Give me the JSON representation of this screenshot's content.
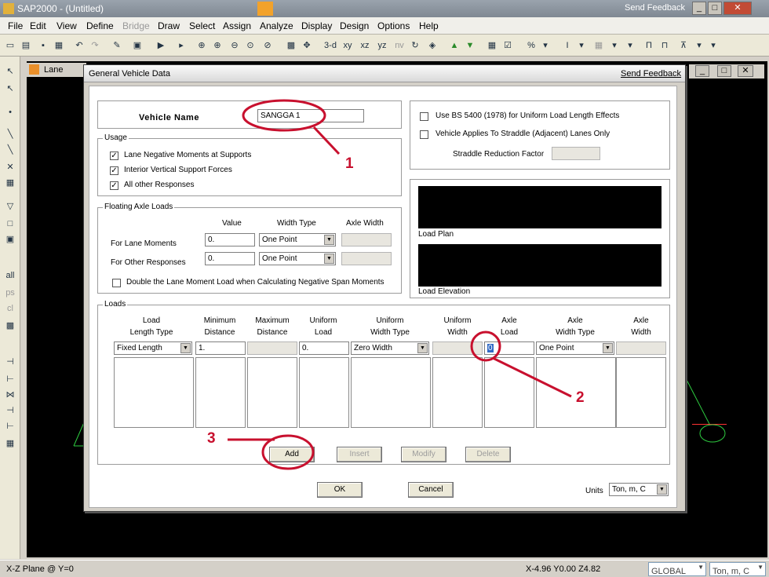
{
  "app": {
    "title": "SAP2000 - (Untitled)",
    "send_feedback": "Send Feedback"
  },
  "menu": [
    "File",
    "Edit",
    "View",
    "Define",
    "Bridge",
    "Draw",
    "Select",
    "Assign",
    "Analyze",
    "Display",
    "Design",
    "Options",
    "Help"
  ],
  "toolbar": {
    "items": [
      "3-d",
      "xy",
      "xz",
      "yz",
      "nv"
    ]
  },
  "lane_tab": "Lane",
  "dialog": {
    "title": "General Vehicle Data",
    "send_feedback": "Send Feedback",
    "vehicle_name_label": "Vehicle Name",
    "vehicle_name_value": "SANGGA 1",
    "usage": {
      "title": "Usage",
      "options": [
        {
          "label": "Lane Negative Moments at Supports",
          "checked": true
        },
        {
          "label": "Interior Vertical Support Forces",
          "checked": true
        },
        {
          "label": "All other Responses",
          "checked": true
        }
      ]
    },
    "bs5400": {
      "label": "Use BS 5400 (1978)  for Uniform Load Length Effects",
      "checked": false
    },
    "straddle": {
      "label": "Vehicle Applies To Straddle (Adjacent) Lanes Only",
      "checked": false
    },
    "straddle_factor_label": "Straddle Reduction Factor",
    "floating": {
      "title": "Floating Axle Loads",
      "col_value": "Value",
      "col_width_type": "Width Type",
      "col_axle_width": "Axle Width",
      "rows": [
        {
          "label": "For Lane Moments",
          "value": "0.",
          "width_type": "One Point"
        },
        {
          "label": "For Other Responses",
          "value": "0.",
          "width_type": "One Point"
        }
      ],
      "double_label": "Double the Lane Moment Load when Calculating Negative Span Moments"
    },
    "load_plan": "Load Plan",
    "load_elevation": "Load Elevation",
    "loads": {
      "title": "Loads",
      "headers": [
        [
          "Load",
          "Length Type"
        ],
        [
          "Minimum",
          "Distance"
        ],
        [
          "Maximum",
          "Distance"
        ],
        [
          "Uniform",
          "Load"
        ],
        [
          "Uniform",
          "Width Type"
        ],
        [
          "Uniform",
          "Width"
        ],
        [
          "Axle",
          "Load"
        ],
        [
          "Axle",
          "Width Type"
        ],
        [
          "Axle",
          "Width"
        ]
      ],
      "row": {
        "length_type": "Fixed Length",
        "min_distance": "1.",
        "uniform_load": "0.",
        "uniform_width_type": "Zero Width",
        "axle_load": "0",
        "axle_width_type": "One Point"
      }
    },
    "buttons": {
      "add": "Add",
      "insert": "Insert",
      "modify": "Modify",
      "delete": "Delete",
      "ok": "OK",
      "cancel": "Cancel"
    },
    "units_label": "Units",
    "units_value": "Ton, m, C"
  },
  "annotations": [
    "1",
    "2",
    "3"
  ],
  "status": {
    "plane": "X-Z Plane @ Y=0",
    "coords": "X-4.96  Y0.00  Z4.82",
    "coord_sys": "GLOBAL",
    "units": "Ton, m, C"
  },
  "colors": {
    "annotation": "#c8102e"
  }
}
